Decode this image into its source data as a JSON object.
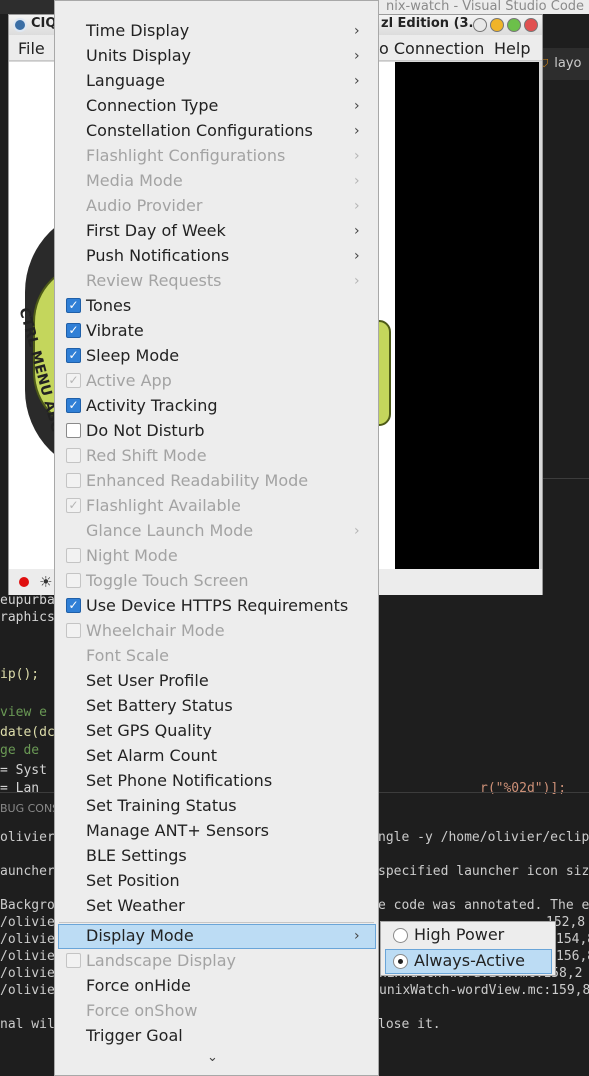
{
  "vscode": {
    "window_title": "nix-watch - Visual Studio Code",
    "tab_label": "layo",
    "code_lines": [
      "eupurbat",
      "raphics",
      "ip();",
      "view e",
      "date(dc",
      "ge de",
      "= Syst",
      "= Lan"
    ],
    "code_right_fragment": "r(\"%02d\")];",
    "panel_title": "BUG CONS",
    "terminal_left": [
      "olivier",
      "auncher",
      "Backgro",
      "/olivie",
      "/olivie",
      "/olivie",
      "/olivie",
      "/olivie",
      "nal wil"
    ],
    "terminal_right": [
      "ngle -y /home/olivier/eclip",
      "specified launcher icon size",
      "e code was annotated. The e",
      "152,8",
      "154,8",
      "156,8",
      "nixWatch-wordView.mc:158,2",
      "unixWatch-wordView.mc:159,8",
      "lose it."
    ]
  },
  "simulator": {
    "title_left": "CIQ",
    "title_right": "zl Edition (3.",
    "menubar": {
      "file": "File",
      "connection": "o Connection",
      "help": "Help"
    },
    "watch_label": "CTRL MENU ABC"
  },
  "menu": {
    "items": [
      {
        "label": "Time Display",
        "type": "submenu",
        "enabled": true
      },
      {
        "label": "Units Display",
        "type": "submenu",
        "enabled": true
      },
      {
        "label": "Language",
        "type": "submenu",
        "enabled": true
      },
      {
        "label": "Connection Type",
        "type": "submenu",
        "enabled": true
      },
      {
        "label": "Constellation Configurations",
        "type": "submenu",
        "enabled": true
      },
      {
        "label": "Flashlight Configurations",
        "type": "submenu",
        "enabled": false
      },
      {
        "label": "Media Mode",
        "type": "submenu",
        "enabled": false
      },
      {
        "label": "Audio Provider",
        "type": "submenu",
        "enabled": false
      },
      {
        "label": "First Day of Week",
        "type": "submenu",
        "enabled": true
      },
      {
        "label": "Push Notifications",
        "type": "submenu",
        "enabled": true
      },
      {
        "label": "Review Requests",
        "type": "submenu",
        "enabled": false
      },
      {
        "label": "Tones",
        "type": "check",
        "checked": true,
        "enabled": true
      },
      {
        "label": "Vibrate",
        "type": "check",
        "checked": true,
        "enabled": true
      },
      {
        "label": "Sleep Mode",
        "type": "check",
        "checked": true,
        "enabled": true
      },
      {
        "label": "Active App",
        "type": "check",
        "checked": true,
        "enabled": false
      },
      {
        "label": "Activity Tracking",
        "type": "check",
        "checked": true,
        "enabled": true
      },
      {
        "label": "Do Not Disturb",
        "type": "check",
        "checked": false,
        "enabled": true
      },
      {
        "label": "Red Shift Mode",
        "type": "check",
        "checked": false,
        "enabled": false
      },
      {
        "label": "Enhanced Readability Mode",
        "type": "check",
        "checked": false,
        "enabled": false
      },
      {
        "label": "Flashlight Available",
        "type": "check",
        "checked": true,
        "enabled": false
      },
      {
        "label": "Glance Launch Mode",
        "type": "submenu",
        "enabled": false
      },
      {
        "label": "Night Mode",
        "type": "check",
        "checked": false,
        "enabled": false
      },
      {
        "label": "Toggle Touch Screen",
        "type": "check",
        "checked": false,
        "enabled": false
      },
      {
        "label": "Use Device HTTPS Requirements",
        "type": "check",
        "checked": true,
        "enabled": true
      },
      {
        "label": "Wheelchair Mode",
        "type": "check",
        "checked": false,
        "enabled": false
      },
      {
        "label": "Font Scale",
        "type": "action",
        "enabled": false
      },
      {
        "label": "Set User Profile",
        "type": "action",
        "enabled": true
      },
      {
        "label": "Set Battery Status",
        "type": "action",
        "enabled": true
      },
      {
        "label": "Set GPS Quality",
        "type": "action",
        "enabled": true
      },
      {
        "label": "Set Alarm Count",
        "type": "action",
        "enabled": true
      },
      {
        "label": "Set Phone Notifications",
        "type": "action",
        "enabled": true
      },
      {
        "label": "Set Training Status",
        "type": "action",
        "enabled": true
      },
      {
        "label": "Manage ANT+ Sensors",
        "type": "action",
        "enabled": true
      },
      {
        "label": "BLE Settings",
        "type": "action",
        "enabled": true
      },
      {
        "label": "Set Position",
        "type": "action",
        "enabled": true
      },
      {
        "label": "Set Weather",
        "type": "action",
        "enabled": true
      },
      {
        "label": "Display Mode",
        "type": "submenu",
        "enabled": true,
        "highlighted": true
      },
      {
        "label": "Landscape Display",
        "type": "check",
        "checked": false,
        "enabled": false
      },
      {
        "label": "Force onHide",
        "type": "action",
        "enabled": true
      },
      {
        "label": "Force onShow",
        "type": "action",
        "enabled": false
      },
      {
        "label": "Trigger Goal",
        "type": "action",
        "enabled": true
      }
    ],
    "scroll_down_icon": "chevron-down-icon"
  },
  "submenu": {
    "items": [
      {
        "label": "High Power",
        "selected": false
      },
      {
        "label": "Always-Active",
        "selected": true
      }
    ]
  },
  "colors": {
    "menu_bg": "#ededed",
    "highlight": "#bcdcf4",
    "check_on": "#2f7fd6",
    "disabled_text": "#a3a3a3"
  }
}
